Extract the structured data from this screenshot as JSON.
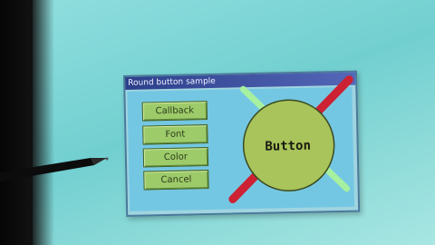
{
  "window": {
    "title": "Round button sample"
  },
  "buttons": {
    "callback": "Callback",
    "font": "Font",
    "color": "Color",
    "cancel": "Cancel"
  },
  "round_button": {
    "label": "Button"
  },
  "colors": {
    "button_fill": "#9ecb6a",
    "round_fill": "#a8c45a",
    "accent_line": "#cc2233",
    "light_line": "#a6f0a0",
    "panel_bg": "#74c7e3",
    "title_bar": "#2c3f8a"
  }
}
